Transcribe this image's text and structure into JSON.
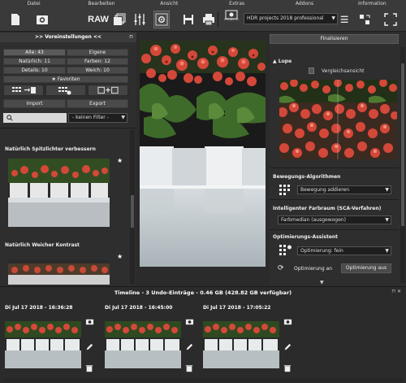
{
  "menu": [
    "Datei",
    "Bearbeiten",
    "Ansicht",
    "Extras",
    "Addons",
    "Information"
  ],
  "toolbar": {
    "raw_label": "RAW",
    "projects_label": "PROJECTS",
    "project_select": "HDR projects 2018 professional"
  },
  "presets": {
    "header": ">> Voreinstellungen <<",
    "filters": {
      "all": "Alle: 43",
      "own": "Eigene",
      "natural": "Natürlich: 11",
      "colors": "Farben: 12",
      "details": "Details: 10",
      "soft": "Weich: 10",
      "favorites": "Favoriten"
    },
    "import_label": "Import",
    "export_label": "Export",
    "filter_select": "- keinen Filter -",
    "items": [
      {
        "title": "Natürlich Spitzlichter verbessern",
        "star": "★"
      },
      {
        "title": "Natürlich Weicher Kontrast",
        "star": "★"
      }
    ]
  },
  "right": {
    "finalize_label": "Finalisieren",
    "loupe": "Lupe",
    "compare_view": "Vergleichsansicht",
    "motion_header": "Bewegungs-Algorithmen",
    "motion_select": "Bewegung addieren",
    "colorspace_header": "Intelligenter Farbraum (SCA-Verfahren)",
    "colorspace_select": "Farbmedian (ausgewogen)",
    "optimize_header": "Optimierungs-Assistent",
    "optimize_select": "Optimierung: fein",
    "optimize_on": "Optimierung an",
    "optimize_off": "Optimierung aus"
  },
  "timeline": {
    "header": "Timeline - 3 Undo-Einträge - 0.46 GB (428.82 GB verfügbar)",
    "entries": [
      {
        "timestamp": "Di Jul 17 2018 - 16:36:28"
      },
      {
        "timestamp": "Di Jul 17 2018 - 16:45:00"
      },
      {
        "timestamp": "Di Jul 17 2018 - 17:05:22"
      }
    ]
  },
  "colors": {
    "background": "#2b2b2b",
    "panel": "#2e2e2e",
    "accent_flowers": "#d4483a",
    "leaf_green": "#3e6b2a"
  }
}
